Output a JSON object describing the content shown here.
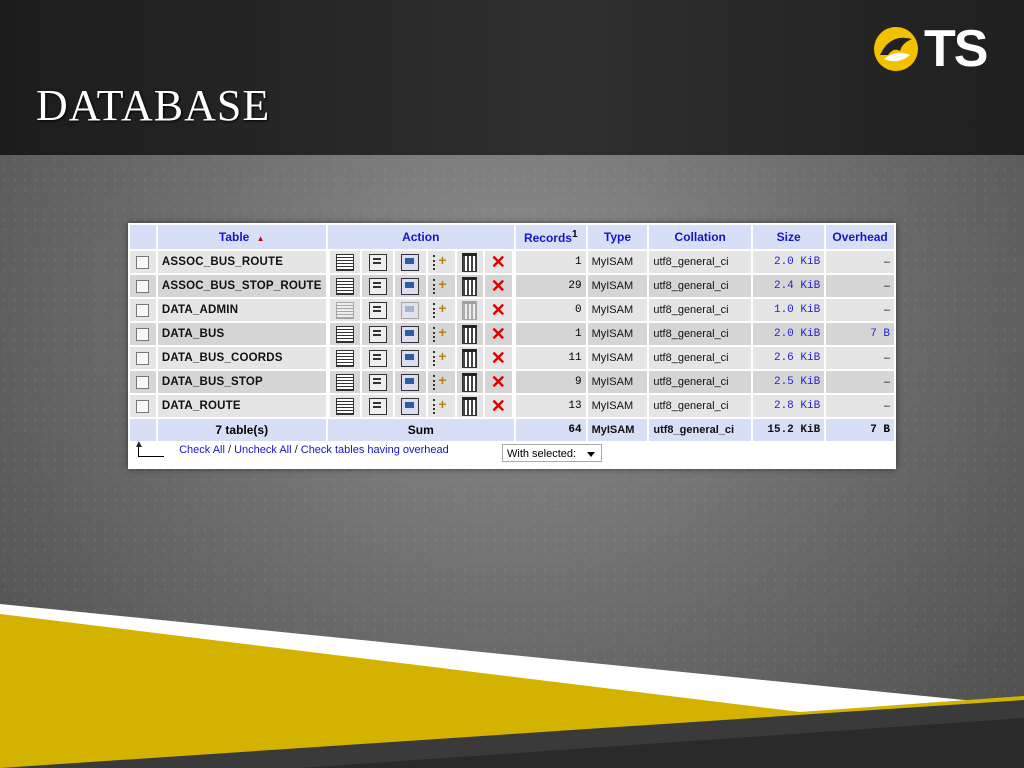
{
  "slide": {
    "title": "DATABASE",
    "logo_text": "TS"
  },
  "table": {
    "headers": {
      "table": "Table",
      "sort_indicator": "▲",
      "action": "Action",
      "records": "Records",
      "records_sup": "1",
      "type": "Type",
      "collation": "Collation",
      "size": "Size",
      "overhead": "Overhead"
    },
    "rows": [
      {
        "name": "ASSOC_BUS_ROUTE",
        "records": "1",
        "type": "MyISAM",
        "collation": "utf8_general_ci",
        "size": "2.0 KiB",
        "overhead": "–"
      },
      {
        "name": "ASSOC_BUS_STOP_ROUTE",
        "records": "29",
        "type": "MyISAM",
        "collation": "utf8_general_ci",
        "size": "2.4 KiB",
        "overhead": "–"
      },
      {
        "name": "DATA_ADMIN",
        "records": "0",
        "type": "MyISAM",
        "collation": "utf8_general_ci",
        "size": "1.0 KiB",
        "overhead": "–"
      },
      {
        "name": "DATA_BUS",
        "records": "1",
        "type": "MyISAM",
        "collation": "utf8_general_ci",
        "size": "2.0 KiB",
        "overhead": "7 B"
      },
      {
        "name": "DATA_BUS_COORDS",
        "records": "11",
        "type": "MyISAM",
        "collation": "utf8_general_ci",
        "size": "2.6 KiB",
        "overhead": "–"
      },
      {
        "name": "DATA_BUS_STOP",
        "records": "9",
        "type": "MyISAM",
        "collation": "utf8_general_ci",
        "size": "2.5 KiB",
        "overhead": "–"
      },
      {
        "name": "DATA_ROUTE",
        "records": "13",
        "type": "MyISAM",
        "collation": "utf8_general_ci",
        "size": "2.8 KiB",
        "overhead": "–"
      }
    ],
    "summary": {
      "tables": "7 table(s)",
      "action": "Sum",
      "records": "64",
      "type": "MyISAM",
      "collation": "utf8_general_ci",
      "size": "15.2 KiB",
      "overhead": "7 B"
    },
    "icons": [
      "browse-icon",
      "structure-icon",
      "search-icon",
      "insert-icon",
      "empty-icon",
      "drop-icon"
    ]
  },
  "footer": {
    "check_all": "Check All",
    "sep1": " / ",
    "uncheck_all": "Uncheck All",
    "sep2": " / ",
    "check_overhead": "Check tables having overhead",
    "with_selected": "With selected:"
  },
  "colors": {
    "header_bg": "#d6dff5",
    "link": "#1515c8",
    "accent_gold": "#f2c200"
  }
}
